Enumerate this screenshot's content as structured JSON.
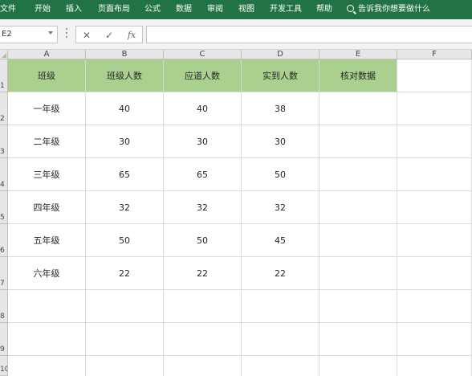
{
  "ribbon": {
    "tabs": [
      "文件",
      "开始",
      "插入",
      "页面布局",
      "公式",
      "数据",
      "审阅",
      "视图",
      "开发工具",
      "帮助"
    ],
    "search_label": "告诉我你想要做什么",
    "search_icon": "search-icon",
    "bar_color": "#217346"
  },
  "formula_bar": {
    "name_box": "E2",
    "cancel_icon": "✕",
    "confirm_icon": "✓",
    "function_icon": "fx",
    "formula_value": ""
  },
  "sheet": {
    "columns": [
      "A",
      "B",
      "C",
      "D",
      "E",
      "F"
    ],
    "rows": [
      "1",
      "2",
      "3",
      "4",
      "5",
      "6",
      "7",
      "8",
      "9",
      "10"
    ],
    "header_fill": "#a9d08e",
    "header": [
      "班级",
      "班级人数",
      "应道人数",
      "实到人数",
      "核对数据"
    ],
    "data": [
      [
        "一年级",
        "40",
        "40",
        "38",
        ""
      ],
      [
        "二年级",
        "30",
        "30",
        "30",
        ""
      ],
      [
        "三年级",
        "65",
        "65",
        "50",
        ""
      ],
      [
        "四年级",
        "32",
        "32",
        "32",
        ""
      ],
      [
        "五年级",
        "50",
        "50",
        "45",
        ""
      ],
      [
        "六年级",
        "22",
        "22",
        "22",
        ""
      ]
    ]
  }
}
